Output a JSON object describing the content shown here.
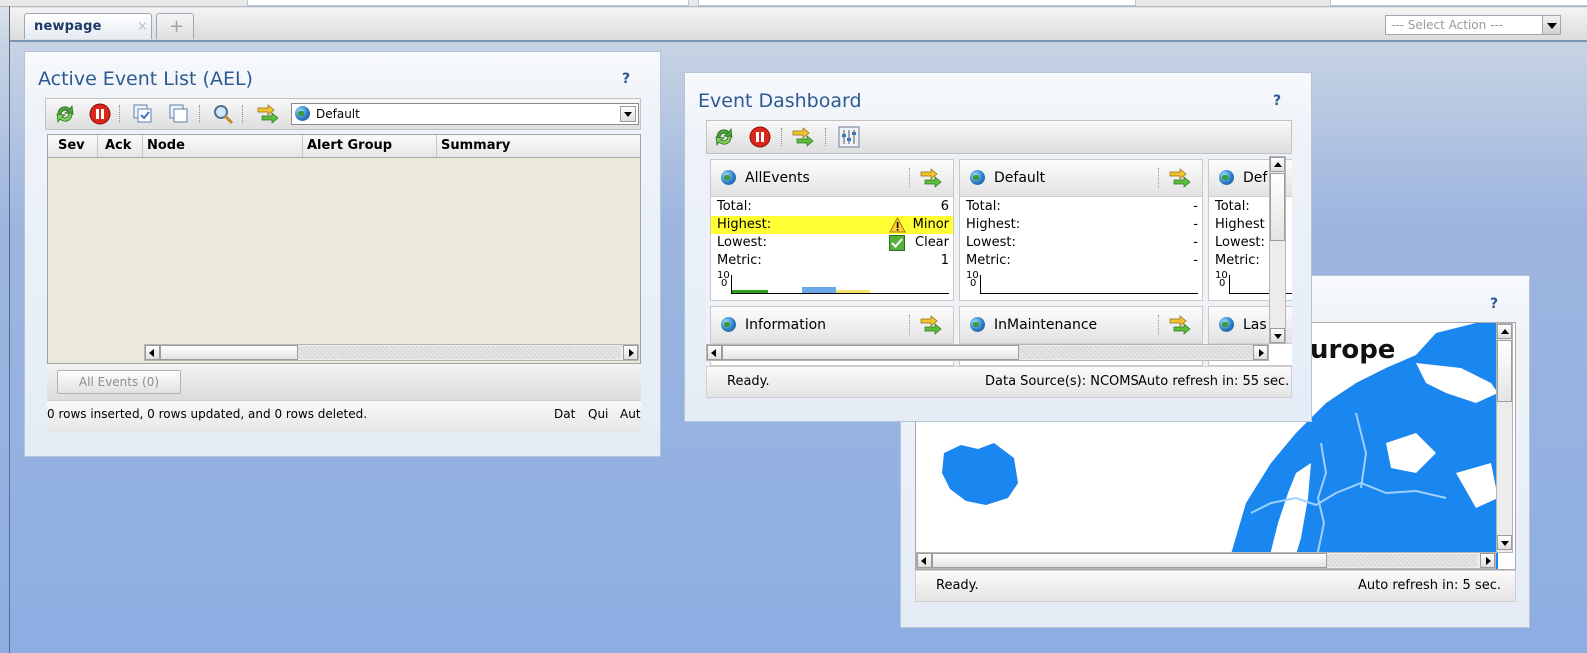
{
  "tabs": [
    {
      "label": "newpage",
      "close": "×"
    }
  ],
  "add_tab_symbol": "+",
  "select_action": {
    "placeholder": "--- Select Action ---"
  },
  "ael": {
    "title": "Active Event List (AEL)",
    "help": "?",
    "filter_value": "Default",
    "columns": [
      "Sev",
      "Ack",
      "Node",
      "Alert Group",
      "Summary"
    ],
    "filter_button": "All Events (0)",
    "status_text": "0 rows inserted, 0 rows updated, and 0 rows deleted.",
    "status_right": [
      "Dat",
      "Qui",
      "Aut"
    ]
  },
  "dashboard": {
    "title": "Event Dashboard",
    "help": "?",
    "tiles": [
      {
        "name": "AllEvents",
        "rows": [
          {
            "label": "Total:",
            "value": "6"
          },
          {
            "label": "Highest:",
            "value": "Minor"
          },
          {
            "label": "Lowest:",
            "value": "Clear"
          },
          {
            "label": "Metric:",
            "value": "1"
          }
        ],
        "axis_top": "10",
        "axis_bottom": "0"
      },
      {
        "name": "Default",
        "rows": [
          {
            "label": "Total:",
            "value": "-"
          },
          {
            "label": "Highest:",
            "value": "-"
          },
          {
            "label": "Lowest:",
            "value": "-"
          },
          {
            "label": "Metric:",
            "value": "-"
          }
        ],
        "axis_top": "10",
        "axis_bottom": "0"
      },
      {
        "name": "Def",
        "rows": [
          {
            "label": "Total:"
          },
          {
            "label": "Highest"
          },
          {
            "label": "Lowest:"
          },
          {
            "label": "Metric:"
          }
        ],
        "axis_top": "10",
        "axis_bottom": "0"
      }
    ],
    "tiles_row2": [
      "Information",
      "InMaintenance",
      "Las"
    ],
    "status_ready": "Ready.",
    "data_sources": "Data Source(s): NCOMS",
    "auto_refresh": "Auto refresh in: 55 sec."
  },
  "map_portlet": {
    "help": "?",
    "title_fragment": "urope",
    "status_ready": "Ready.",
    "auto_refresh": "Auto refresh in: 5 sec."
  },
  "colors": {
    "title_blue": "#2d5a93",
    "highlight_yellow": "#ffff33",
    "map_blue": "#1a86f0"
  }
}
